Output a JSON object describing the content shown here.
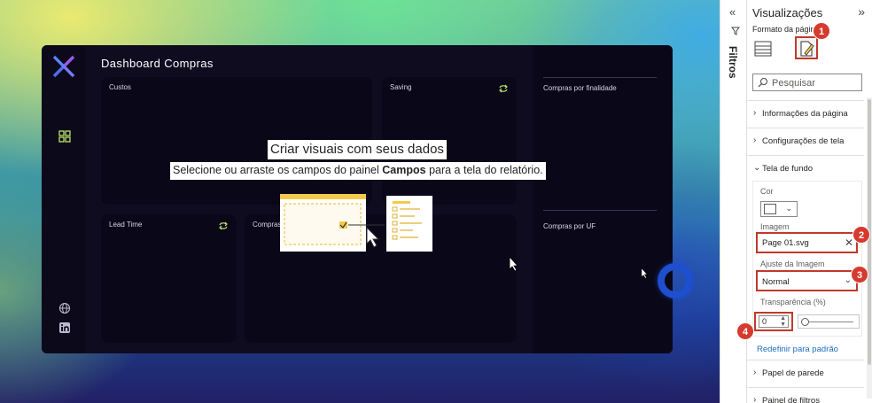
{
  "dashboard": {
    "title": "Dashboard Compras",
    "cards": {
      "custos": "Custos",
      "saving": "Saving",
      "lead_time": "Lead Time",
      "compras": "Compras"
    },
    "right": {
      "finalidade": "Compras por finalidade",
      "uf": "Compras por UF"
    },
    "empty_state": {
      "title": "Criar visuais com seus dados",
      "sub_before": "Selecione ou arraste os campos do painel ",
      "sub_bold": "Campos",
      "sub_after": " para a tela do relatório."
    }
  },
  "filters_pane": {
    "label": "Filtros"
  },
  "viz_pane": {
    "title": "Visualizações",
    "subtitle": "Formato da págin",
    "search_placeholder": "Pesquisar",
    "sections": {
      "info": "Informações da página",
      "config": "Configurações de tela",
      "tela": "Tela de fundo",
      "papel": "Papel de parede",
      "painel": "Painel de filtros"
    },
    "tela_de_fundo": {
      "cor_label": "Cor",
      "imagem_label": "Imagem",
      "imagem_value": "Page 01.svg",
      "ajuste_label": "Ajuste da Imagem",
      "ajuste_value": "Normal",
      "transp_label": "Transparência (%)",
      "transp_value": "0"
    },
    "reset_link": "Redefinir para padrão"
  },
  "badges": [
    "1",
    "2",
    "3",
    "4"
  ],
  "colors": {
    "badge": "#d63a2e",
    "dashboard_bg": "#0f0c20",
    "accent_green": "#b9e36b",
    "ring_blue": "#1d4fcf"
  }
}
